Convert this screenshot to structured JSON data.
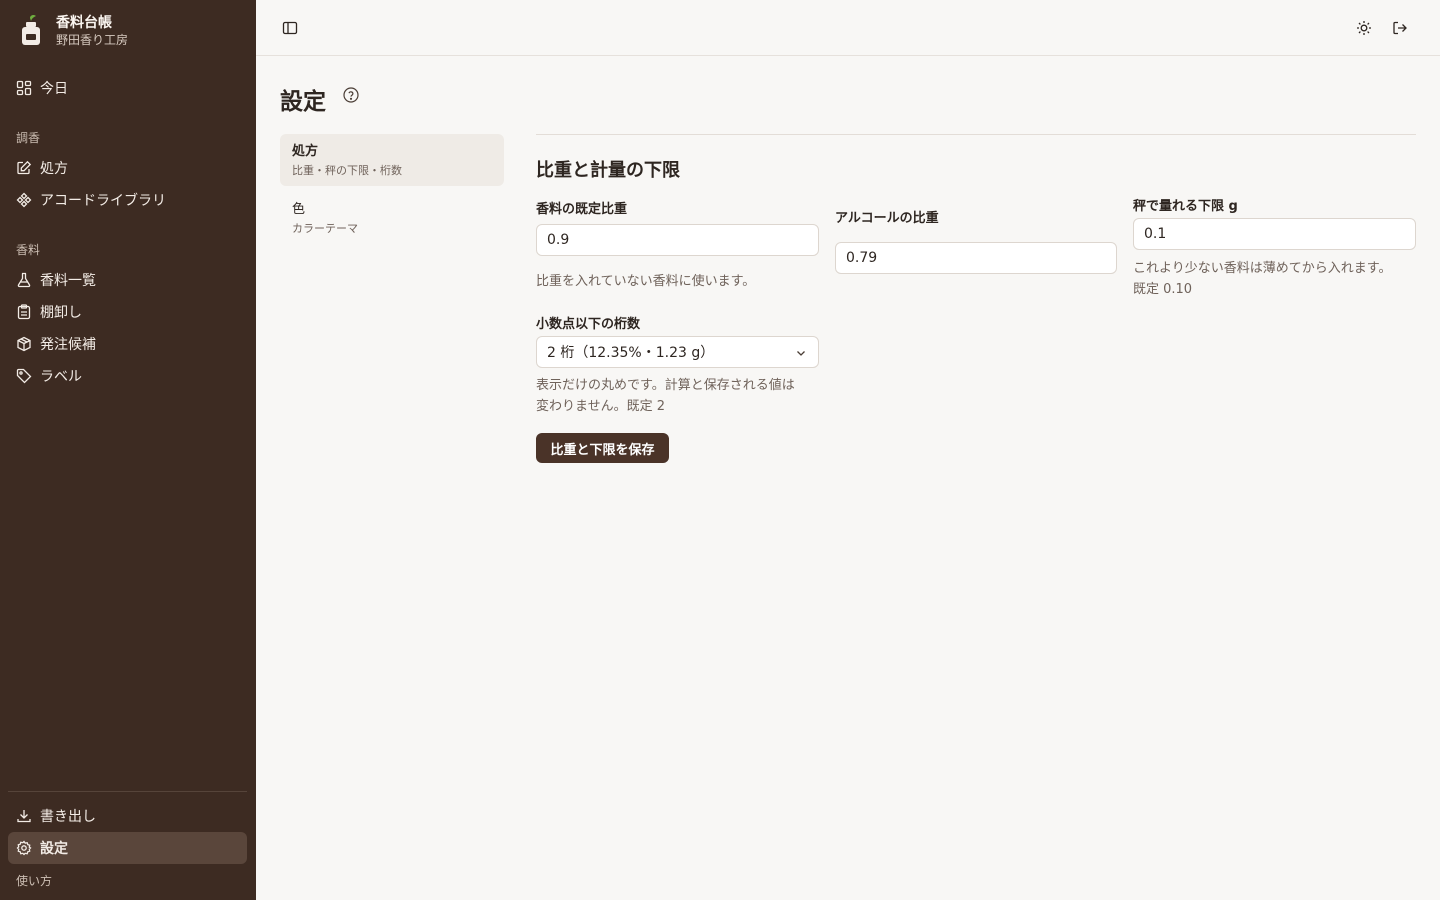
{
  "brand": {
    "title": "香料台帳",
    "subtitle": "野田香り工房"
  },
  "sidebar": {
    "today": "今日",
    "section_chogo": "調香",
    "formula": "処方",
    "accord_library": "アコードライブラリ",
    "section_koryo": "香料",
    "ingredient_list": "香料一覧",
    "inventory": "棚卸し",
    "order_candidates": "発注候補",
    "labels": "ラベル",
    "export": "書き出し",
    "settings": "設定",
    "how_to_use": "使い方"
  },
  "page": {
    "title": "設定"
  },
  "subnav": [
    {
      "label": "処方",
      "desc": "比重・秤の下限・桁数"
    },
    {
      "label": "色",
      "desc": "カラーテーマ"
    }
  ],
  "section": {
    "title": "比重と計量の下限",
    "default_sg": {
      "label": "香料の既定比重",
      "value": "0.9",
      "help": "比重を入れていない香料に使います。"
    },
    "alcohol_sg": {
      "label": "アルコールの比重",
      "value": "0.79"
    },
    "min_weight": {
      "label": "秤で量れる下限 g",
      "value": "0.1",
      "help1": "これより少ない香料は薄めてから入れます。",
      "help2": "既定 0.10"
    },
    "decimals": {
      "label": "小数点以下の桁数",
      "value": "2 桁（12.35%・1.23 g）",
      "help1": "表示だけの丸めです。計算と保存される値は",
      "help2": "変わりません。既定 2"
    },
    "save_label": "比重と下限を保存"
  }
}
